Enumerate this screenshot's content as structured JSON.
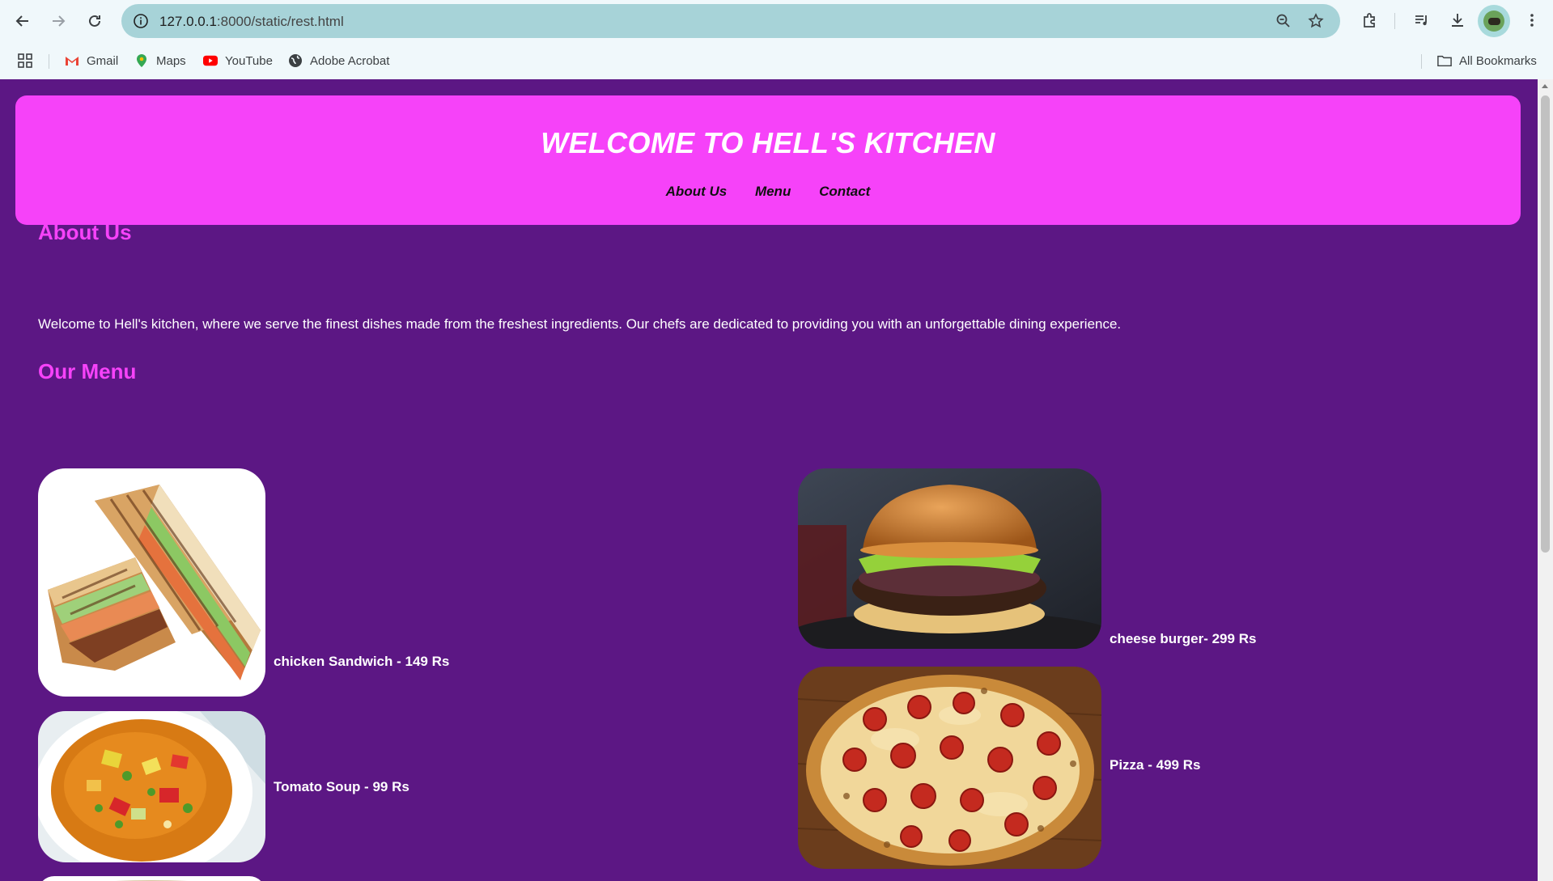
{
  "browser": {
    "url_host": "127.0.0.1",
    "url_path": ":8000/static/rest.html",
    "bookmarks": [
      {
        "label": "Gmail",
        "icon": "gmail-icon"
      },
      {
        "label": "Maps",
        "icon": "maps-icon"
      },
      {
        "label": "YouTube",
        "icon": "youtube-icon"
      },
      {
        "label": "Adobe Acrobat",
        "icon": "globe-icon"
      }
    ],
    "all_bookmarks_label": "All Bookmarks"
  },
  "site": {
    "title": "WELCOME TO HELL'S KITCHEN",
    "nav": [
      "About Us",
      "Menu",
      "Contact"
    ],
    "header_color": "#f642f9",
    "background_color": "#5c1784"
  },
  "about": {
    "heading": "About Us",
    "text": "Welcome to Hell's kitchen, where we serve the finest dishes made from the freshest ingredients. Our chefs are dedicated to providing you with an unforgettable dining experience."
  },
  "menu": {
    "heading": "Our Menu",
    "items": [
      {
        "label": "chicken Sandwich - 149 Rs",
        "image": "sandwich-image"
      },
      {
        "label": "cheese burger- 299 Rs",
        "image": "burger-image"
      },
      {
        "label": "Tomato Soup - 99 Rs",
        "image": "soup-image"
      },
      {
        "label": "Pizza - 499 Rs",
        "image": "pizza-image"
      }
    ]
  }
}
